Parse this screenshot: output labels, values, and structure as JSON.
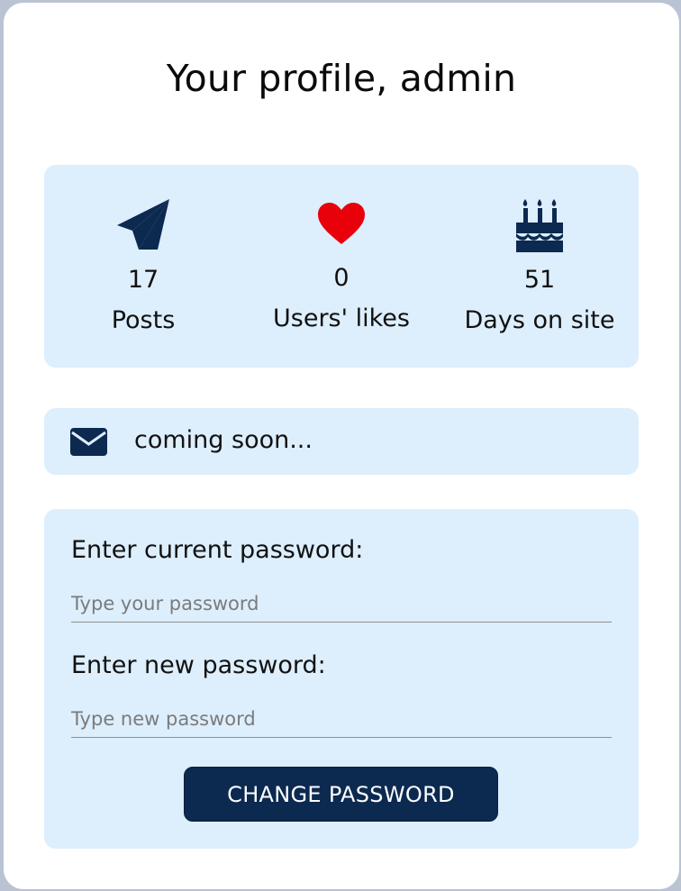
{
  "page": {
    "title": "Your profile, admin"
  },
  "stats": [
    {
      "icon": "paper-plane-icon",
      "value": "17",
      "label": "Posts"
    },
    {
      "icon": "heart-icon",
      "value": "0",
      "label": "Users' likes"
    },
    {
      "icon": "birthday-cake-icon",
      "value": "51",
      "label": "Days on site"
    }
  ],
  "messages": {
    "icon": "envelope-icon",
    "text": "coming soon..."
  },
  "password_form": {
    "current_label": "Enter current password:",
    "current_placeholder": "Type your password",
    "new_label": "Enter new password:",
    "new_placeholder": "Type new password",
    "submit_label": "CHANGE PASSWORD"
  },
  "colors": {
    "accent": "#0c2950",
    "panel_bg": "#ddeefc",
    "heart": "#e8000b"
  }
}
